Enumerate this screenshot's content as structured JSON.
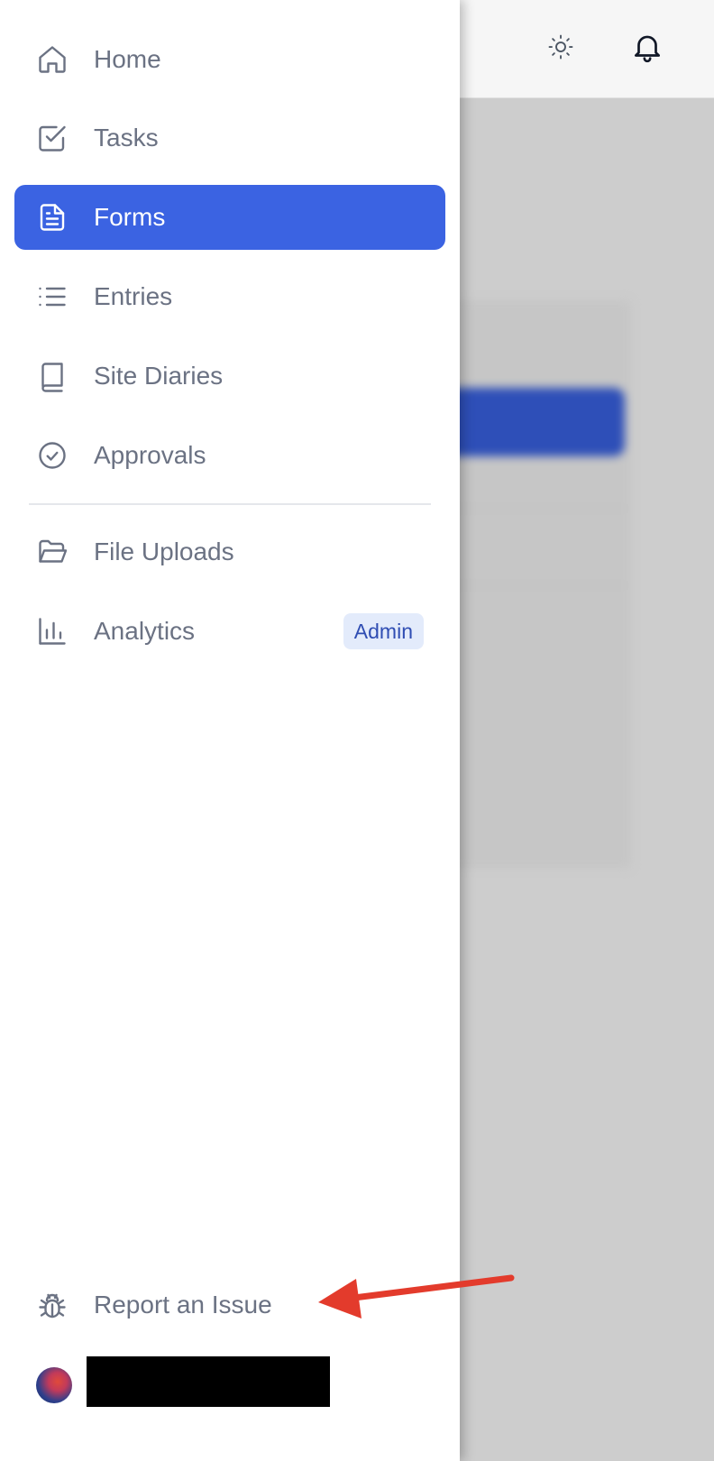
{
  "header": {
    "theme_icon": "sun-icon",
    "notification_icon": "bell-icon"
  },
  "sidebar": {
    "items": [
      {
        "label": "Home",
        "icon": "home-icon",
        "active": false
      },
      {
        "label": "Tasks",
        "icon": "checkbox-icon",
        "active": false
      },
      {
        "label": "Forms",
        "icon": "document-icon",
        "active": true
      },
      {
        "label": "Entries",
        "icon": "list-icon",
        "active": false
      },
      {
        "label": "Site Diaries",
        "icon": "book-icon",
        "active": false
      },
      {
        "label": "Approvals",
        "icon": "check-circle-icon",
        "active": false
      }
    ],
    "secondary_items": [
      {
        "label": "File Uploads",
        "icon": "folder-open-icon"
      },
      {
        "label": "Analytics",
        "icon": "bar-chart-icon",
        "badge": "Admin"
      }
    ],
    "footer": {
      "report_label": "Report an Issue",
      "report_icon": "bug-icon"
    },
    "user": {
      "avatar_icon": "avatar",
      "name_redacted": true
    }
  },
  "colors": {
    "active_bg": "#3b63e2",
    "label_text": "#6b7283",
    "badge_bg": "#e3ebfb",
    "badge_text": "#2f4db3",
    "annotation_arrow": "#e33b2c"
  }
}
